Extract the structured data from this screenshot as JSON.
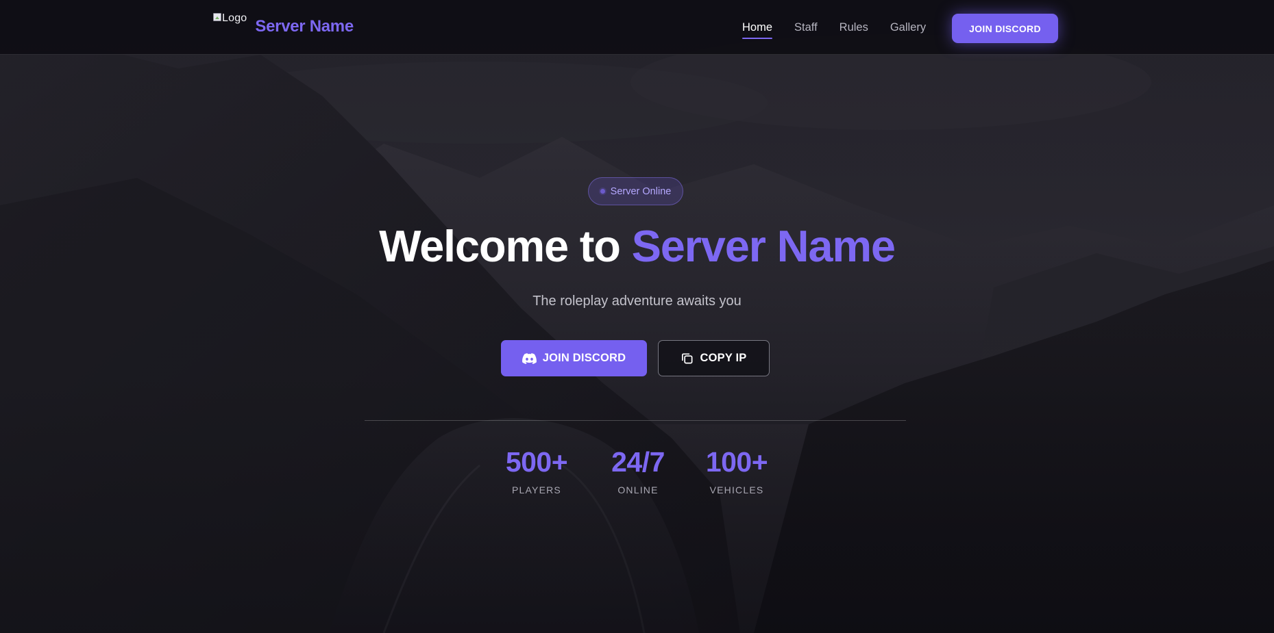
{
  "brand": {
    "logo_alt": "Logo",
    "name": "Server Name"
  },
  "nav": {
    "links": [
      {
        "label": "Home",
        "active": true
      },
      {
        "label": "Staff",
        "active": false
      },
      {
        "label": "Rules",
        "active": false
      },
      {
        "label": "Gallery",
        "active": false
      }
    ],
    "cta_label": "JOIN DISCORD"
  },
  "hero": {
    "status": "Server Online",
    "title_prefix": "Welcome to ",
    "title_accent": "Server Name",
    "subtitle": "The roleplay adventure awaits you",
    "primary_button": {
      "label": "JOIN DISCORD",
      "icon": "discord-icon"
    },
    "secondary_button": {
      "label": "COPY IP",
      "icon": "copy-icon"
    }
  },
  "stats": [
    {
      "value": "500+",
      "label": "PLAYERS"
    },
    {
      "value": "24/7",
      "label": "ONLINE"
    },
    {
      "value": "100+",
      "label": "VEHICLES"
    }
  ],
  "colors": {
    "accent": "#7d68f2",
    "button": "#7560ef",
    "background": "#0f0e14",
    "text": "#ffffff",
    "muted": "#b6b5c0"
  }
}
